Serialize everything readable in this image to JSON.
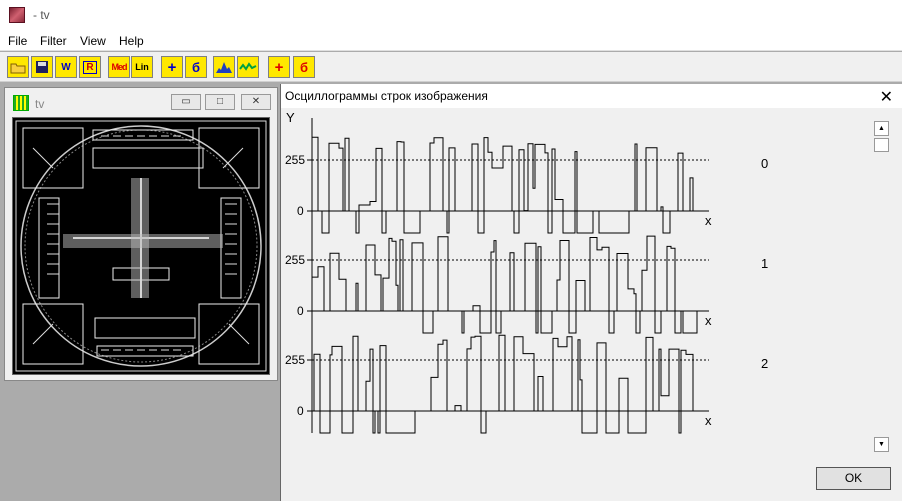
{
  "window": {
    "title": "- tv"
  },
  "menu": [
    "File",
    "Filter",
    "View",
    "Help"
  ],
  "toolbar": {
    "buttons": [
      {
        "name": "open-icon",
        "label": ""
      },
      {
        "name": "save-icon",
        "label": ""
      },
      {
        "name": "w-icon",
        "label": "W"
      },
      {
        "name": "r-icon",
        "label": "R"
      },
      {
        "name": "med-button",
        "label": "Med"
      },
      {
        "name": "lin-button",
        "label": "Lin"
      },
      {
        "name": "plus-blue-icon",
        "label": "+"
      },
      {
        "name": "blue-b-icon",
        "label": "б"
      },
      {
        "name": "histogram-icon",
        "label": ""
      },
      {
        "name": "wave-icon",
        "label": ""
      },
      {
        "name": "plus-red-icon",
        "label": "+"
      },
      {
        "name": "red-b-icon",
        "label": "б"
      }
    ]
  },
  "tv_window": {
    "title": "tv",
    "minimize": "▭",
    "maximize": "□",
    "close": "✕"
  },
  "dialog": {
    "title": "Осциллограммы строк изображения",
    "close": "✕",
    "ok_label": "OK"
  },
  "chart_data": {
    "type": "line",
    "y_axis_label": "Y",
    "x_axis_label": "x",
    "series": [
      {
        "name": "0",
        "ticks": [
          "255",
          "0"
        ]
      },
      {
        "name": "1",
        "ticks": [
          "255",
          "0"
        ]
      },
      {
        "name": "2",
        "ticks": [
          "255",
          "0"
        ]
      }
    ],
    "ylim": [
      0,
      255
    ],
    "note_values": "step waveforms per image row; y values range 0..255 with drops below zero baseline"
  }
}
